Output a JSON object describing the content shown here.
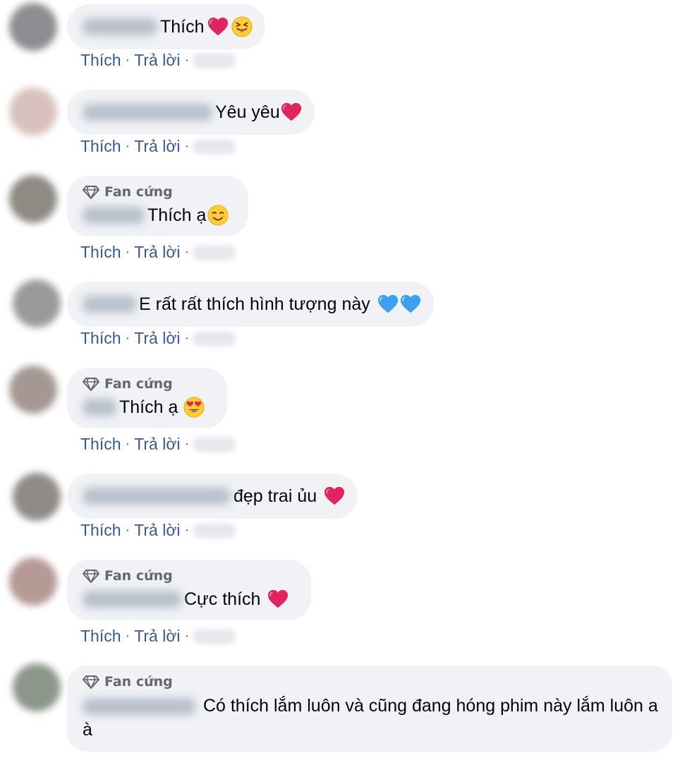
{
  "actions": {
    "like_label": "Thích",
    "reply_label": "Trả lời",
    "separator": "·"
  },
  "badge_label": "Fan cứng",
  "comments": [
    {
      "text": "Thích",
      "emojis": [
        "heart-emoji",
        "squinting-tongue-emoji"
      ],
      "badge": false
    },
    {
      "text": "Yêu yêu",
      "emojis": [
        "heart-emoji"
      ],
      "badge": false
    },
    {
      "text": "Thích ạ",
      "emojis": [
        "smiling-blush-emoji"
      ],
      "badge": true
    },
    {
      "text": "E rất rất thích hình tượng này",
      "emojis": [
        "blue-heart-emoji",
        "blue-heart-emoji"
      ],
      "badge": false
    },
    {
      "text": "Thích ạ",
      "emojis": [
        "heart-eyes-emoji"
      ],
      "badge": true
    },
    {
      "text": "đẹp trai ủu",
      "emojis": [
        "heart-emoji"
      ],
      "badge": false
    },
    {
      "text": "Cực thích",
      "emojis": [
        "heart-emoji"
      ],
      "badge": true
    },
    {
      "text": "Có thích lắm luôn và cũng đang hóng phim này lắm luôn a à",
      "emojis": [],
      "badge": true
    }
  ],
  "colors": {
    "bubble": "#f0f2f5",
    "link": "#385898",
    "meta": "#65676b",
    "heart": "#e0245e",
    "blue_heart": "#3ba0f0"
  }
}
